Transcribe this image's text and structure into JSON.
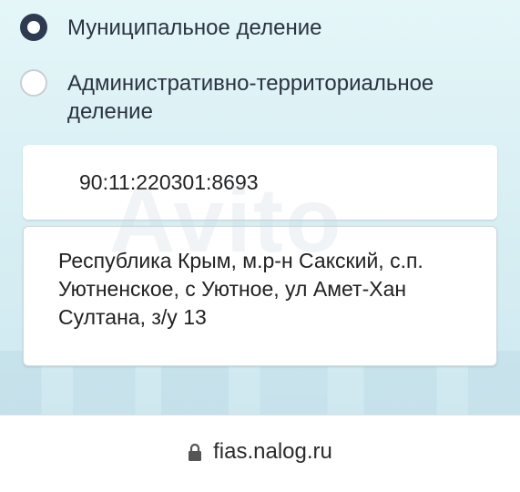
{
  "options": [
    {
      "label": "Муниципальное деление",
      "selected": true
    },
    {
      "label": "Административно-территориальное деление",
      "selected": false
    }
  ],
  "cadastral_number": "90:11:220301:8693",
  "address": "Республика Крым, м.р-н Сакский, с.п. Уютненское, с Уютное, ул Амет-Хан Султана, з/у 13",
  "watermark": "Avito",
  "browser": {
    "url": "fias.nalog.ru",
    "lock_icon": "lock-icon"
  }
}
